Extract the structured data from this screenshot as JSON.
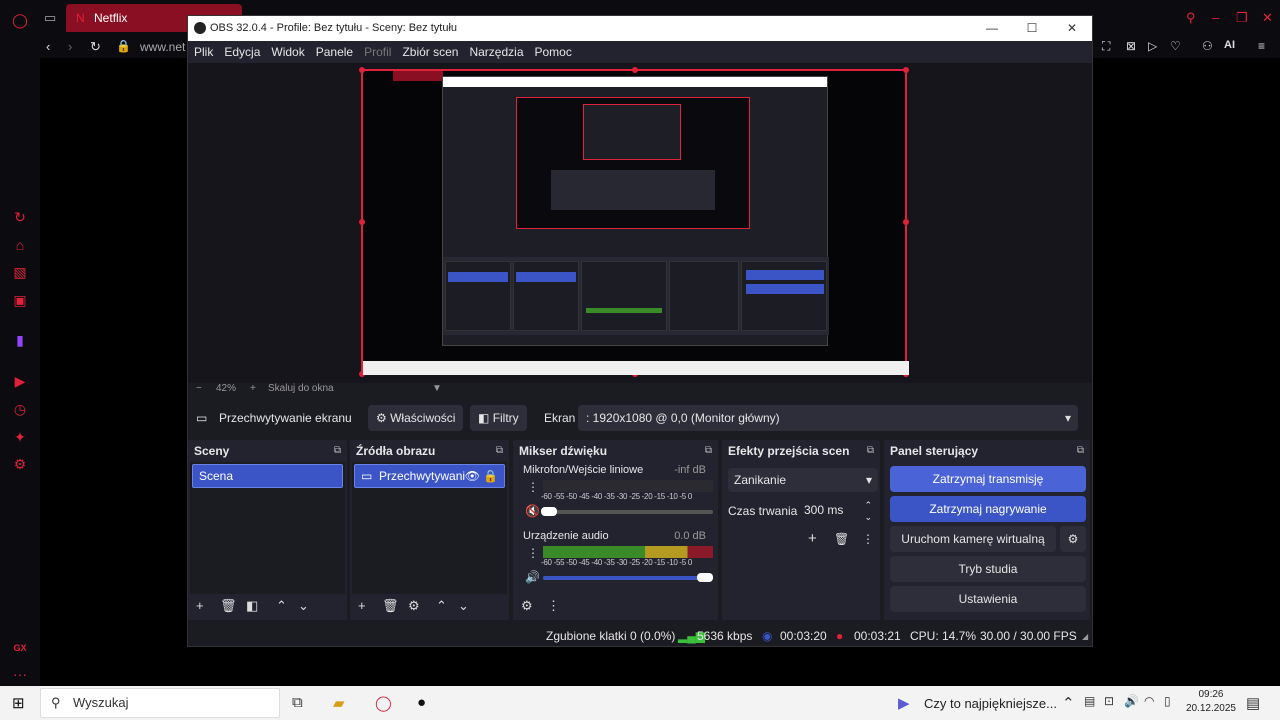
{
  "browser": {
    "tab_title": "Netflix",
    "address": "www.net",
    "ai_label": "AI"
  },
  "obs": {
    "window_title": "OBS 32.0.4 - Profile: Bez tytułu - Sceny: Bez tytułu",
    "menu": [
      "Plik",
      "Edycja",
      "Widok",
      "Panele",
      "Profil",
      "Zbiór scen",
      "Narzędzia",
      "Pomoc"
    ],
    "zoom": {
      "minus": "−",
      "percent": "42%",
      "plus": "+",
      "fit_label": "Skaluj do okna"
    },
    "source_toolbar": {
      "source_name": "Przechwytywanie ekranu",
      "properties_label": "Właściwości",
      "filters_label": "Filtry",
      "screen_label": "Ekran",
      "screen_value": ": 1920x1080 @ 0,0 (Monitor główny)"
    },
    "docks": {
      "scenes": {
        "title": "Sceny",
        "items": [
          "Scena"
        ]
      },
      "sources": {
        "title": "Źródła obrazu",
        "items": [
          "Przechwytywani"
        ]
      },
      "mixer": {
        "title": "Mikser dźwięku",
        "channels": [
          {
            "name": "Mikrofon/Wejście liniowe",
            "db": "-inf dB",
            "level": 0.0,
            "muted": true
          },
          {
            "name": "Urządzenie audio",
            "db": "0.0 dB",
            "level": 1.0,
            "muted": false
          }
        ],
        "ticks": "-60 -55 -50 -45 -40 -35 -30 -25 -20 -15 -10  -5   0"
      },
      "transitions": {
        "title": "Efekty przejścia scen",
        "transition": "Zanikanie",
        "duration_label": "Czas trwania",
        "duration_value": "300 ms"
      },
      "controls": {
        "title": "Panel sterujący",
        "buttons": [
          "Zatrzymaj transmisję",
          "Zatrzymaj nagrywanie",
          "Uruchom kamerę wirtualną",
          "Tryb studia",
          "Ustawienia"
        ]
      }
    },
    "status": {
      "dropped": "Zgubione klatki 0 (0.0%)",
      "bitrate": "5636 kbps",
      "stream_time": "00:03:20",
      "rec_time": "00:03:21",
      "cpu": "CPU: 14.7%",
      "fps": "30.00 / 30.00 FPS"
    }
  },
  "taskbar": {
    "search_placeholder": "Wyszukaj",
    "media_text": "Czy to najpiękniejsze...",
    "time": "09:26",
    "date": "20.12.2025"
  },
  "colors": {
    "accent_red": "#e0213a",
    "obs_blue": "#3b55c7",
    "obs_bg": "#1b1b22"
  }
}
